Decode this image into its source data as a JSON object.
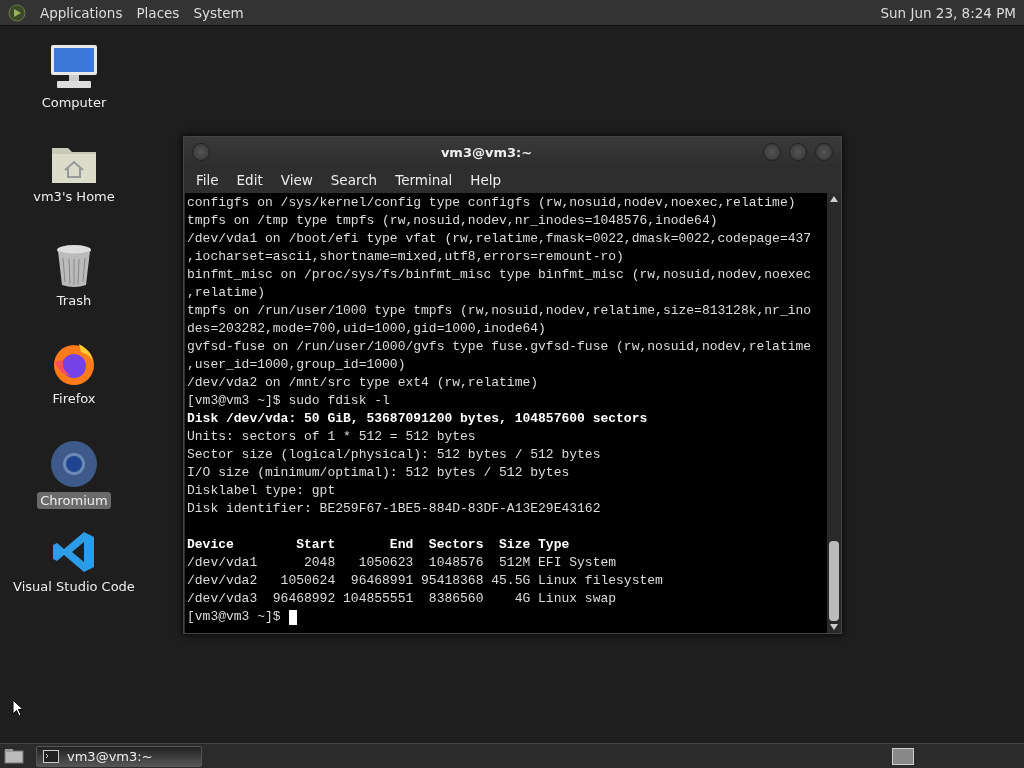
{
  "top_panel": {
    "menus": [
      "Applications",
      "Places",
      "System"
    ],
    "clock": "Sun Jun 23,  8:24 PM"
  },
  "desktop_icons": [
    {
      "kind": "computer",
      "label": "Computer",
      "selected": false
    },
    {
      "kind": "home",
      "label": "vm3's Home",
      "selected": false
    },
    {
      "kind": "trash",
      "label": "Trash",
      "selected": false
    },
    {
      "kind": "firefox",
      "label": "Firefox",
      "selected": false
    },
    {
      "kind": "chromium",
      "label": "Chromium",
      "selected": true
    },
    {
      "kind": "vscode",
      "label": "Visual Studio Code",
      "selected": false
    }
  ],
  "window": {
    "title": "vm3@vm3:~",
    "menu": [
      "File",
      "Edit",
      "View",
      "Search",
      "Terminal",
      "Help"
    ],
    "lines": [
      {
        "text": "configfs on /sys/kernel/config type configfs (rw,nosuid,nodev,noexec,relatime)",
        "bold": false
      },
      {
        "text": "tmpfs on /tmp type tmpfs (rw,nosuid,nodev,nr_inodes=1048576,inode64)",
        "bold": false
      },
      {
        "text": "/dev/vda1 on /boot/efi type vfat (rw,relatime,fmask=0022,dmask=0022,codepage=437",
        "bold": false
      },
      {
        "text": ",iocharset=ascii,shortname=mixed,utf8,errors=remount-ro)",
        "bold": false
      },
      {
        "text": "binfmt_misc on /proc/sys/fs/binfmt_misc type binfmt_misc (rw,nosuid,nodev,noexec",
        "bold": false
      },
      {
        "text": ",relatime)",
        "bold": false
      },
      {
        "text": "tmpfs on /run/user/1000 type tmpfs (rw,nosuid,nodev,relatime,size=813128k,nr_ino",
        "bold": false
      },
      {
        "text": "des=203282,mode=700,uid=1000,gid=1000,inode64)",
        "bold": false
      },
      {
        "text": "gvfsd-fuse on /run/user/1000/gvfs type fuse.gvfsd-fuse (rw,nosuid,nodev,relatime",
        "bold": false
      },
      {
        "text": ",user_id=1000,group_id=1000)",
        "bold": false
      },
      {
        "text": "/dev/vda2 on /mnt/src type ext4 (rw,relatime)",
        "bold": false
      },
      {
        "text": "[vm3@vm3 ~]$ sudo fdisk -l",
        "bold": false
      },
      {
        "text": "Disk /dev/vda: 50 GiB, 53687091200 bytes, 104857600 sectors",
        "bold": true
      },
      {
        "text": "Units: sectors of 1 * 512 = 512 bytes",
        "bold": false
      },
      {
        "text": "Sector size (logical/physical): 512 bytes / 512 bytes",
        "bold": false
      },
      {
        "text": "I/O size (minimum/optimal): 512 bytes / 512 bytes",
        "bold": false
      },
      {
        "text": "Disklabel type: gpt",
        "bold": false
      },
      {
        "text": "Disk identifier: BE259F67-1BE5-884D-83DF-A13E29E43162",
        "bold": false
      }
    ],
    "table_lines": [
      {
        "text": "Device        Start       End  Sectors  Size Type",
        "bold": true
      },
      {
        "text": "/dev/vda1      2048   1050623  1048576  512M EFI System",
        "bold": false
      },
      {
        "text": "/dev/vda2   1050624  96468991 95418368 45.5G Linux filesystem",
        "bold": false
      },
      {
        "text": "/dev/vda3  96468992 104855551  8386560    4G Linux swap",
        "bold": false
      }
    ],
    "prompt": "[vm3@vm3 ~]$"
  },
  "taskbar": {
    "tasks": [
      {
        "label": "vm3@vm3:~",
        "selected": true
      }
    ]
  }
}
